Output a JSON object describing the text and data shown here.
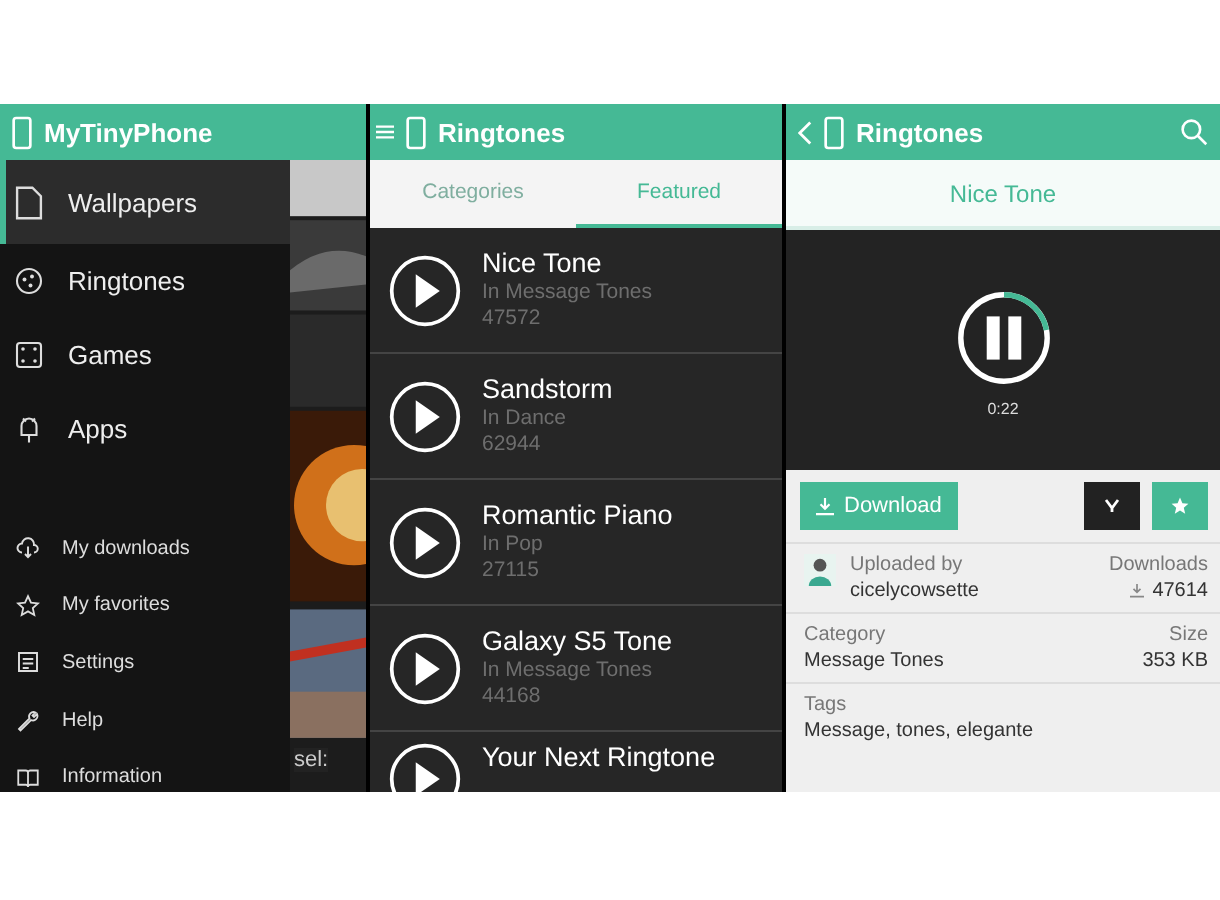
{
  "panels": [
    {
      "header": {
        "title": "MyTinyPhone"
      },
      "drawer": {
        "main_items": [
          {
            "label": "Wallpapers",
            "selected": true
          },
          {
            "label": "Ringtones",
            "selected": false
          },
          {
            "label": "Games",
            "selected": false
          },
          {
            "label": "Apps",
            "selected": false
          }
        ],
        "secondary_items": [
          {
            "label": "My downloads"
          },
          {
            "label": "My favorites"
          },
          {
            "label": "Settings"
          },
          {
            "label": "Help"
          },
          {
            "label": "Information"
          }
        ]
      },
      "background_label": "sel:"
    },
    {
      "header": {
        "title": "Ringtones"
      },
      "tabs": [
        {
          "label": "Categories",
          "selected": false
        },
        {
          "label": "Featured",
          "selected": true
        }
      ],
      "ringtones": [
        {
          "name": "Nice Tone",
          "category": "In Message Tones",
          "count": "47572"
        },
        {
          "name": "Sandstorm",
          "category": "In Dance",
          "count": "62944"
        },
        {
          "name": "Romantic Piano",
          "category": "In Pop",
          "count": "27115"
        },
        {
          "name": "Galaxy S5 Tone",
          "category": "In Message Tones",
          "count": "44168"
        },
        {
          "name": "Your Next Ringtone"
        }
      ]
    },
    {
      "header": {
        "title": "Ringtones"
      },
      "tone_title": "Nice Tone",
      "player": {
        "playing": true,
        "level": 0.22,
        "time": "0:22"
      },
      "download_button": "Download",
      "favorite": true,
      "uploaded_by_label": "Uploaded by",
      "uploader": "cicelycowsette",
      "downloads_label": "Downloads",
      "downloads": "47614",
      "category_label": "Category",
      "category": "Message Tones",
      "size_label": "Size",
      "size": "353 KB",
      "tags_label": "Tags",
      "tags": "Message, tones, elegante"
    }
  ]
}
